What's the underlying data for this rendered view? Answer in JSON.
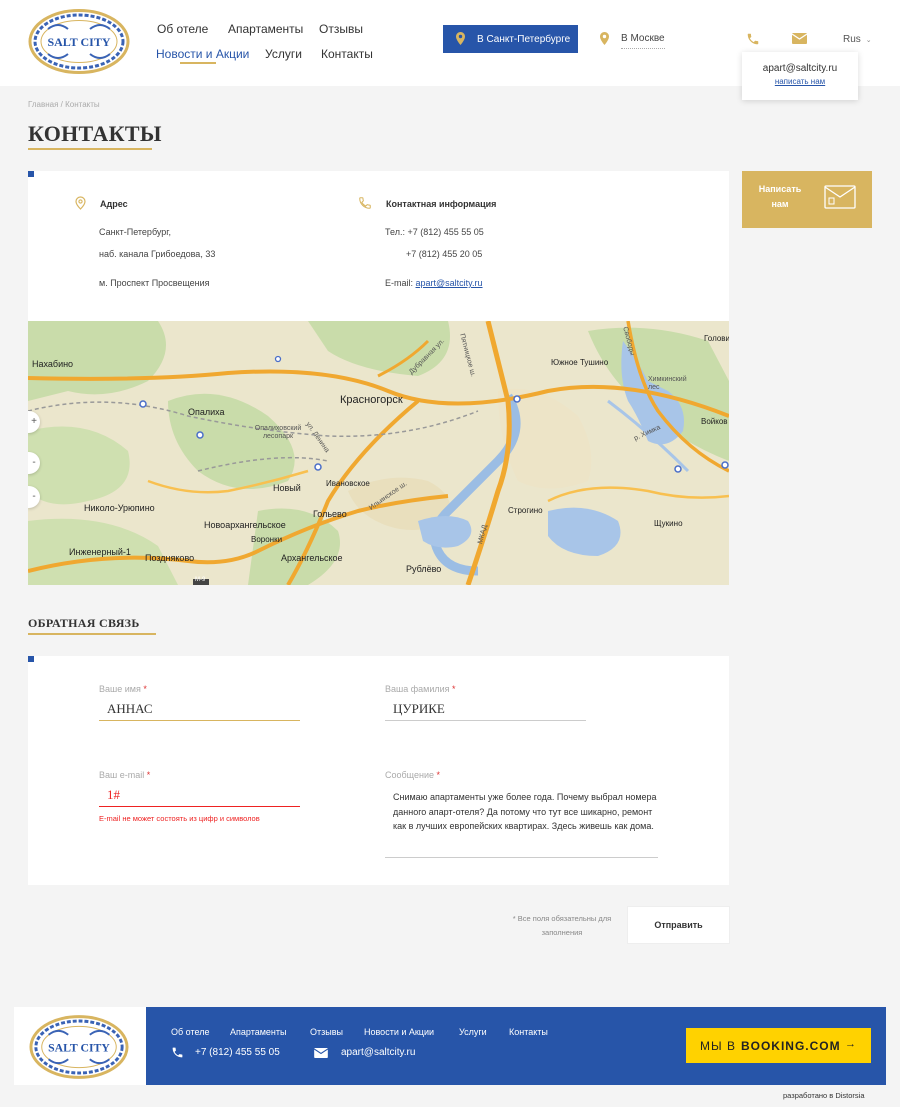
{
  "header": {
    "logo_text": "SALT CITY",
    "nav": [
      "Об отеле",
      "Апартаменты",
      "Отзывы",
      "Новости и Акции",
      "Услуги",
      "Контакты"
    ],
    "active_nav": "Новости и Акции",
    "city_primary": "В Санкт-Петербурге",
    "city_secondary": "В Москве",
    "lang": "Rus",
    "popup_email": "apart@saltcity.ru",
    "popup_write": "написать нам"
  },
  "breadcrumb": "Главная / Контакты",
  "page_title": "КОНТАКТЫ",
  "contacts": {
    "address_title": "Адрес",
    "address_lines": [
      "Санкт-Петербург,",
      "наб. канала Грибоедова, 33"
    ],
    "metro": "м. Проспект Просвещения",
    "info_title": "Контактная информация",
    "phone_line1": "Тел.: +7 (812) 455 55 05",
    "phone_line2": "+7 (812) 455 20 05",
    "email_label": "E-mail:",
    "email": "apart@saltcity.ru"
  },
  "write_us": "Написать нам",
  "map": {
    "labels": [
      "Нахабино",
      "Опалиха",
      "Опалиховский лесопарк",
      "Красногорск",
      "Ивановское",
      "Новый",
      "Николо-Урюпино",
      "Новоархангельское",
      "Воронки",
      "Гольево",
      "Архангельское",
      "Инженерный-1",
      "Поздняково",
      "Строгино",
      "Рублёво",
      "Щукино",
      "Южное Тушино",
      "Химкинский лес",
      "Головин",
      "Войков",
      "ул. Ленина",
      "Ильинское ш.",
      "Пятницкое ш.",
      "МКАД",
      "Дубравная ул.",
      "Свободы",
      "р. Химка",
      "М-9"
    ]
  },
  "feedback": {
    "title": "ОБРАТНАЯ СВЯЗЬ",
    "first_name_label": "Ваше имя",
    "first_name_value": "АННАС",
    "last_name_label": "Ваша фамилия",
    "last_name_value": "ЦУРИКЕ",
    "email_label": "Ваш e-mail",
    "email_value": "1#",
    "email_error": "E-mail не может состоять из цифр и символов",
    "message_label": "Сообщение",
    "message_value": "Снимаю апартаменты уже более года. Почему выбрал номера данного апарт-отеля? Да потому что тут все шикарно, ремонт как в лучших европейских квартирах. Здесь живешь как дома.",
    "required_star": "*",
    "required_note": "* Все поля обязательны для заполнения",
    "submit": "Отправить"
  },
  "footer": {
    "nav": [
      "Об отеле",
      "Апартаменты",
      "Отзывы",
      "Новости и Акции",
      "Услуги",
      "Контакты"
    ],
    "phone": "+7 (812) 455 55 05",
    "email": "apart@saltcity.ru",
    "booking_prefix": "МЫ В",
    "booking_brand": "BOOKING.COM",
    "booking_arrow": "→",
    "developer": "разработано в Distorsia"
  },
  "colors": {
    "brand_blue": "#2755a9",
    "gold": "#d8b560",
    "error": "#e22222",
    "booking_yellow": "#ffd200"
  }
}
